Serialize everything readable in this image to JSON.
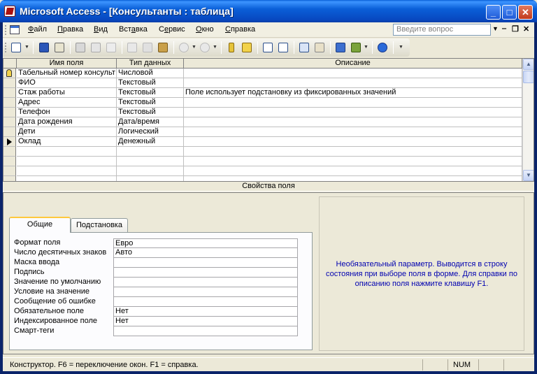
{
  "window": {
    "title": "Microsoft Access - [Консультанты : таблица]",
    "minimize": "_",
    "maximize": "□",
    "close": "✕"
  },
  "menu": {
    "items": [
      {
        "key": "Ф",
        "rest": "айл"
      },
      {
        "key": "П",
        "rest": "равка"
      },
      {
        "key": "В",
        "rest": "ид"
      },
      {
        "key": "",
        "pre": "Вст",
        "u": "а",
        "post": "вка"
      },
      {
        "key": "",
        "pre": "С",
        "u": "е",
        "post": "рвис"
      },
      {
        "key": "О",
        "rest": "кно"
      },
      {
        "key": "С",
        "rest": "правка"
      }
    ],
    "ask_placeholder": "Введите вопрос"
  },
  "grid": {
    "headers": [
      "Имя поля",
      "Тип данных",
      "Описание"
    ],
    "rows": [
      {
        "name": "Табельный номер консульт",
        "type": "Числовой",
        "desc": "",
        "marker": "key"
      },
      {
        "name": "ФИО",
        "type": "Текстовый",
        "desc": "",
        "marker": ""
      },
      {
        "name": "Стаж работы",
        "type": "Текстовый",
        "desc": "Поле использует подстановку из фиксированных значений",
        "marker": ""
      },
      {
        "name": "Адрес",
        "type": "Текстовый",
        "desc": "",
        "marker": ""
      },
      {
        "name": "Телефон",
        "type": "Текстовый",
        "desc": "",
        "marker": ""
      },
      {
        "name": "Дата рождения",
        "type": "Дата/время",
        "desc": "",
        "marker": ""
      },
      {
        "name": "Дети",
        "type": "Логический",
        "desc": "",
        "marker": ""
      },
      {
        "name": "Оклад",
        "type": "Денежный",
        "desc": "",
        "marker": "current"
      },
      {
        "name": "",
        "type": "",
        "desc": "",
        "marker": ""
      },
      {
        "name": "",
        "type": "",
        "desc": "",
        "marker": ""
      },
      {
        "name": "",
        "type": "",
        "desc": "",
        "marker": ""
      },
      {
        "name": "",
        "type": "",
        "desc": "",
        "marker": ""
      }
    ]
  },
  "properties": {
    "title": "Свойства поля",
    "tabs": [
      "Общие",
      "Подстановка"
    ],
    "rows": [
      {
        "label": "Формат поля",
        "value": "Евро"
      },
      {
        "label": "Число десятичных знаков",
        "value": "Авто"
      },
      {
        "label": "Маска ввода",
        "value": ""
      },
      {
        "label": "Подпись",
        "value": ""
      },
      {
        "label": "Значение по умолчанию",
        "value": ""
      },
      {
        "label": "Условие на значение",
        "value": ""
      },
      {
        "label": "Сообщение об ошибке",
        "value": ""
      },
      {
        "label": "Обязательное поле",
        "value": "Нет"
      },
      {
        "label": "Индексированное поле",
        "value": "Нет"
      },
      {
        "label": "Смарт-теги",
        "value": ""
      }
    ],
    "help": "Необязательный параметр.  Выводится в строку состояния при выборе поля в форме.  Для справки по описанию поля нажмите клавишу F1."
  },
  "status": {
    "text": "Конструктор.  F6 = переключение окон.  F1 = справка.",
    "num": "NUM"
  }
}
